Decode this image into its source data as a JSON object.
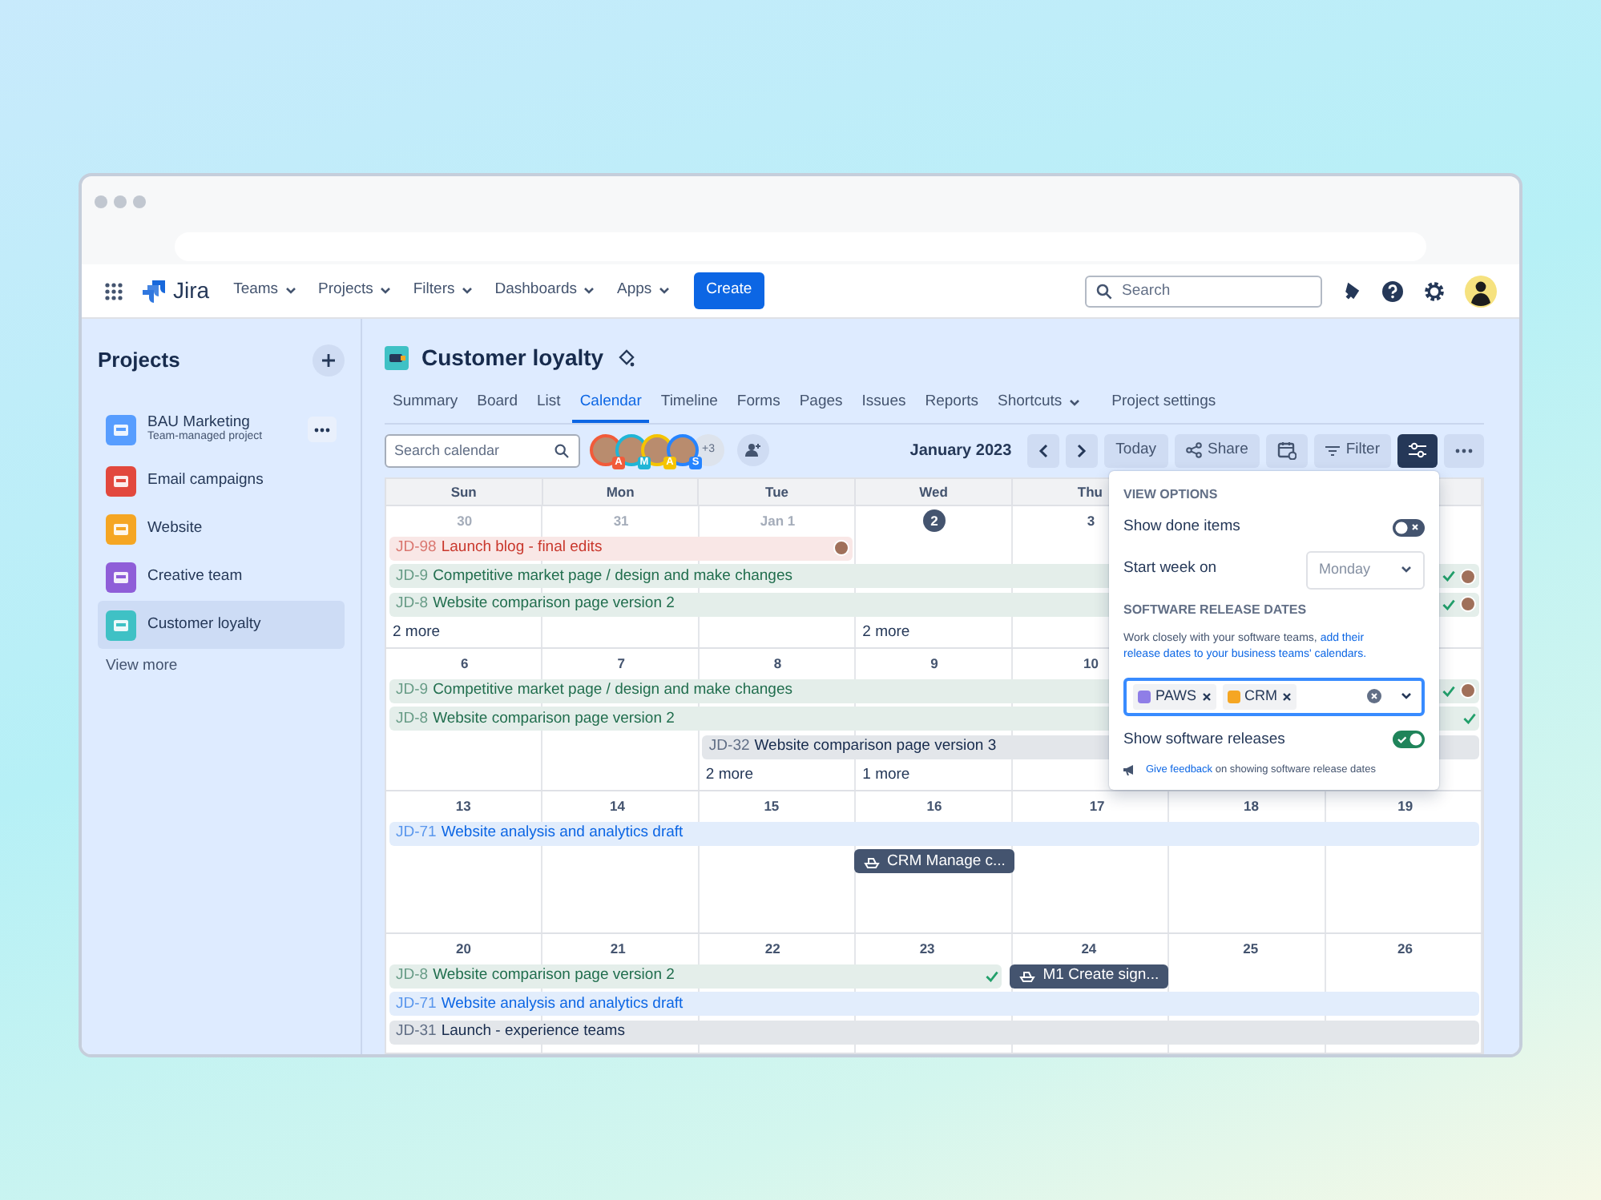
{
  "nav": {
    "product": "Jira",
    "menus": [
      {
        "label": "Teams",
        "dropdown": true
      },
      {
        "label": "Projects",
        "dropdown": true
      },
      {
        "label": "Filters",
        "dropdown": true
      },
      {
        "label": "Dashboards",
        "dropdown": true
      },
      {
        "label": "Apps",
        "dropdown": true
      }
    ],
    "create_button": "Create",
    "search": {
      "placeholder": "Search"
    }
  },
  "sidebar": {
    "title": "Projects",
    "items": [
      {
        "name": "BAU Marketing",
        "subtitle": "Team-managed project",
        "color": "#579dff",
        "selected": false,
        "menu": true
      },
      {
        "name": "Email campaigns",
        "color": "#e2483d",
        "selected": false,
        "menu": false
      },
      {
        "name": "Website",
        "color": "#f5a623",
        "selected": false,
        "menu": false
      },
      {
        "name": "Creative team",
        "color": "#8f5ed8",
        "selected": false,
        "menu": false
      },
      {
        "name": "Customer loyalty",
        "color": "#3fc1c5",
        "selected": true,
        "menu": false
      }
    ],
    "view_more": "View more"
  },
  "project": {
    "title": "Customer loyalty",
    "tabs": [
      {
        "label": "Summary",
        "selected": false,
        "dropdown": false
      },
      {
        "label": "Board",
        "selected": false,
        "dropdown": false
      },
      {
        "label": "List",
        "selected": false,
        "dropdown": false
      },
      {
        "label": "Calendar",
        "selected": true,
        "dropdown": false
      },
      {
        "label": "Timeline",
        "selected": false,
        "dropdown": false
      },
      {
        "label": "Forms",
        "selected": false,
        "dropdown": false
      },
      {
        "label": "Pages",
        "selected": false,
        "dropdown": false
      },
      {
        "label": "Issues",
        "selected": false,
        "dropdown": false
      },
      {
        "label": "Reports",
        "selected": false,
        "dropdown": false
      },
      {
        "label": "Shortcuts",
        "selected": false,
        "dropdown": true
      },
      {
        "label": "Project settings",
        "selected": false,
        "dropdown": false
      }
    ]
  },
  "toolbar": {
    "search": {
      "placeholder": "Search calendar"
    },
    "people": [
      {
        "initial": "A",
        "color": "#f15b3a"
      },
      {
        "initial": "M",
        "color": "#1fb5d6"
      },
      {
        "initial": "A",
        "color": "#f5c400"
      },
      {
        "initial": "S",
        "color": "#2684ff"
      }
    ],
    "more_people": "+3",
    "month": "January 2023",
    "today": "Today",
    "share": "Share",
    "filter": "Filter",
    "view_options_open": true
  },
  "view_options": {
    "rows": [
      {
        "kind": "heading",
        "label": "VIEW OPTIONS"
      },
      {
        "kind": "toggle",
        "label": "Show done items",
        "on": false
      },
      {
        "kind": "select",
        "label": "Start week on",
        "value": "Monday"
      },
      {
        "kind": "heading",
        "label": "SOFTWARE RELEASE DATES"
      },
      {
        "kind": "text",
        "text": "Work closely with your software teams,",
        "links": [
          "add their",
          "release dates to your business teams' calendars."
        ]
      },
      {
        "kind": "tags",
        "tags": [
          {
            "label": "PAWS",
            "color": "#8f7ee7"
          },
          {
            "label": "CRM",
            "color": "#f5a623"
          }
        ]
      },
      {
        "kind": "toggle",
        "label": "Show software releases",
        "on": true
      },
      {
        "kind": "feedback",
        "link": "Give feedback",
        "text": "on showing software release dates"
      }
    ]
  },
  "calendar": {
    "weekdays": [
      "Sun",
      "Mon",
      "Tue",
      "Wed",
      "Thu"
    ],
    "weeks": [
      {
        "dates": [
          {
            "label": "30",
            "muted": true,
            "today": false
          },
          {
            "label": "31",
            "muted": true,
            "today": false
          },
          {
            "label": "Jan 1",
            "muted": true,
            "today": false
          },
          {
            "label": "2",
            "muted": false,
            "today": true
          },
          {
            "label": "3",
            "muted": false,
            "today": false
          }
        ],
        "lanes": [
          [
            {
              "kind": "issue",
              "key": "JD-98",
              "title": "Launch blog - final edits",
              "color": "#c9372c",
              "done": false,
              "avatar": true
            },
            {
              "kind": "extends"
            },
            {
              "kind": "extends"
            }
          ],
          [
            {
              "kind": "issue",
              "key": "JD-9",
              "title": "Competitive market page / design and make changes",
              "color": "#216e4e",
              "done": true,
              "avatar": true
            },
            {
              "kind": "extends"
            },
            {
              "kind": "extends"
            },
            {
              "kind": "extends"
            },
            {
              "kind": "extends"
            },
            {
              "kind": "extends"
            },
            {
              "kind": "extends"
            }
          ],
          [
            {
              "kind": "issue",
              "key": "JD-8",
              "title": "Website comparison page version 2",
              "color": "#216e4e",
              "done": true,
              "avatar": true
            },
            {
              "kind": "extends"
            },
            {
              "kind": "extends"
            },
            {
              "kind": "extends"
            },
            {
              "kind": "extends"
            },
            {
              "kind": "extends"
            },
            {
              "kind": "extends"
            }
          ],
          [
            {
              "kind": "more",
              "label": "2 more"
            },
            {
              "kind": "gap"
            },
            {
              "kind": "gap"
            },
            {
              "kind": "more",
              "label": "2 more"
            }
          ]
        ]
      },
      {
        "dates": [
          {
            "label": "6",
            "muted": false,
            "today": false
          },
          {
            "label": "7",
            "muted": false,
            "today": false
          },
          {
            "label": "8",
            "muted": false,
            "today": false
          },
          {
            "label": "9",
            "muted": false,
            "today": false
          },
          {
            "label": "10",
            "muted": false,
            "today": false
          }
        ],
        "lanes": [
          [
            {
              "kind": "issue",
              "key": "JD-9",
              "title": "Competitive market page / design and make changes",
              "color": "#216e4e",
              "done": true,
              "avatar": true
            },
            {
              "kind": "extends"
            },
            {
              "kind": "extends"
            },
            {
              "kind": "extends"
            },
            {
              "kind": "extends"
            },
            {
              "kind": "extends"
            },
            {
              "kind": "extends"
            }
          ],
          [
            {
              "kind": "issue",
              "key": "JD-8",
              "title": "Website comparison page version 2",
              "color": "#216e4e",
              "done": true,
              "avatar": false
            },
            {
              "kind": "extends"
            },
            {
              "kind": "extends"
            },
            {
              "kind": "extends"
            },
            {
              "kind": "extends"
            },
            {
              "kind": "extends"
            },
            {
              "kind": "extends"
            }
          ],
          [
            {
              "kind": "gap"
            },
            {
              "kind": "gap"
            },
            {
              "kind": "issue",
              "key": "JD-32",
              "title": "Website comparison page version 3",
              "color": "#172b4d",
              "done": false,
              "avatar": false
            },
            {
              "kind": "extends"
            },
            {
              "kind": "extends"
            },
            {
              "kind": "extends"
            },
            {
              "kind": "extends"
            }
          ],
          [
            {
              "kind": "gap"
            },
            {
              "kind": "gap"
            },
            {
              "kind": "more",
              "label": "2 more"
            },
            {
              "kind": "more",
              "label": "1 more"
            }
          ]
        ]
      },
      {
        "dates": [
          {
            "label": "13",
            "muted": false,
            "today": false
          },
          {
            "label": "14",
            "muted": false,
            "today": false
          },
          {
            "label": "15",
            "muted": false,
            "today": false
          },
          {
            "label": "16",
            "muted": false,
            "today": false
          },
          {
            "label": "17",
            "muted": false,
            "today": false
          },
          {
            "label": "18",
            "muted": false,
            "today": false
          },
          {
            "label": "19",
            "muted": false,
            "today": false
          }
        ],
        "lanes": [
          [
            {
              "kind": "issue",
              "key": "JD-71",
              "title": "Website analysis and analytics draft",
              "color": "#0c66e4",
              "done": false,
              "avatar": false
            },
            {
              "kind": "extends"
            },
            {
              "kind": "extends"
            },
            {
              "kind": "extends"
            },
            {
              "kind": "extends"
            },
            {
              "kind": "extends"
            },
            {
              "kind": "extends"
            }
          ],
          [
            {
              "kind": "gap"
            },
            {
              "kind": "gap"
            },
            {
              "kind": "gap"
            },
            {
              "kind": "release",
              "title": "CRM Manage c..."
            }
          ]
        ]
      },
      {
        "dates": [
          {
            "label": "20",
            "muted": false,
            "today": false
          },
          {
            "label": "21",
            "muted": false,
            "today": false
          },
          {
            "label": "22",
            "muted": false,
            "today": false
          },
          {
            "label": "23",
            "muted": false,
            "today": false
          },
          {
            "label": "24",
            "muted": false,
            "today": false
          },
          {
            "label": "25",
            "muted": false,
            "today": false
          },
          {
            "label": "26",
            "muted": false,
            "today": false
          }
        ],
        "lanes": [
          [
            {
              "kind": "issue",
              "key": "JD-8",
              "title": "Website comparison page version 2",
              "color": "#216e4e",
              "done": true,
              "avatar": false
            },
            {
              "kind": "extends"
            },
            {
              "kind": "extends"
            },
            {
              "kind": "extends"
            },
            {
              "kind": "release",
              "title": "M1 Create sign..."
            }
          ],
          [
            {
              "kind": "issue",
              "key": "JD-71",
              "title": "Website analysis and analytics draft",
              "color": "#0c66e4",
              "done": false,
              "avatar": false
            },
            {
              "kind": "extends"
            },
            {
              "kind": "extends"
            },
            {
              "kind": "extends"
            },
            {
              "kind": "extends"
            },
            {
              "kind": "extends"
            },
            {
              "kind": "extends"
            }
          ],
          [
            {
              "kind": "issue",
              "key": "JD-31",
              "title": "Launch - experience teams",
              "color": "#172b4d",
              "done": false,
              "avatar": false
            },
            {
              "kind": "extends"
            },
            {
              "kind": "extends"
            },
            {
              "kind": "extends"
            },
            {
              "kind": "extends"
            },
            {
              "kind": "extends"
            },
            {
              "kind": "extends"
            }
          ]
        ]
      }
    ]
  }
}
